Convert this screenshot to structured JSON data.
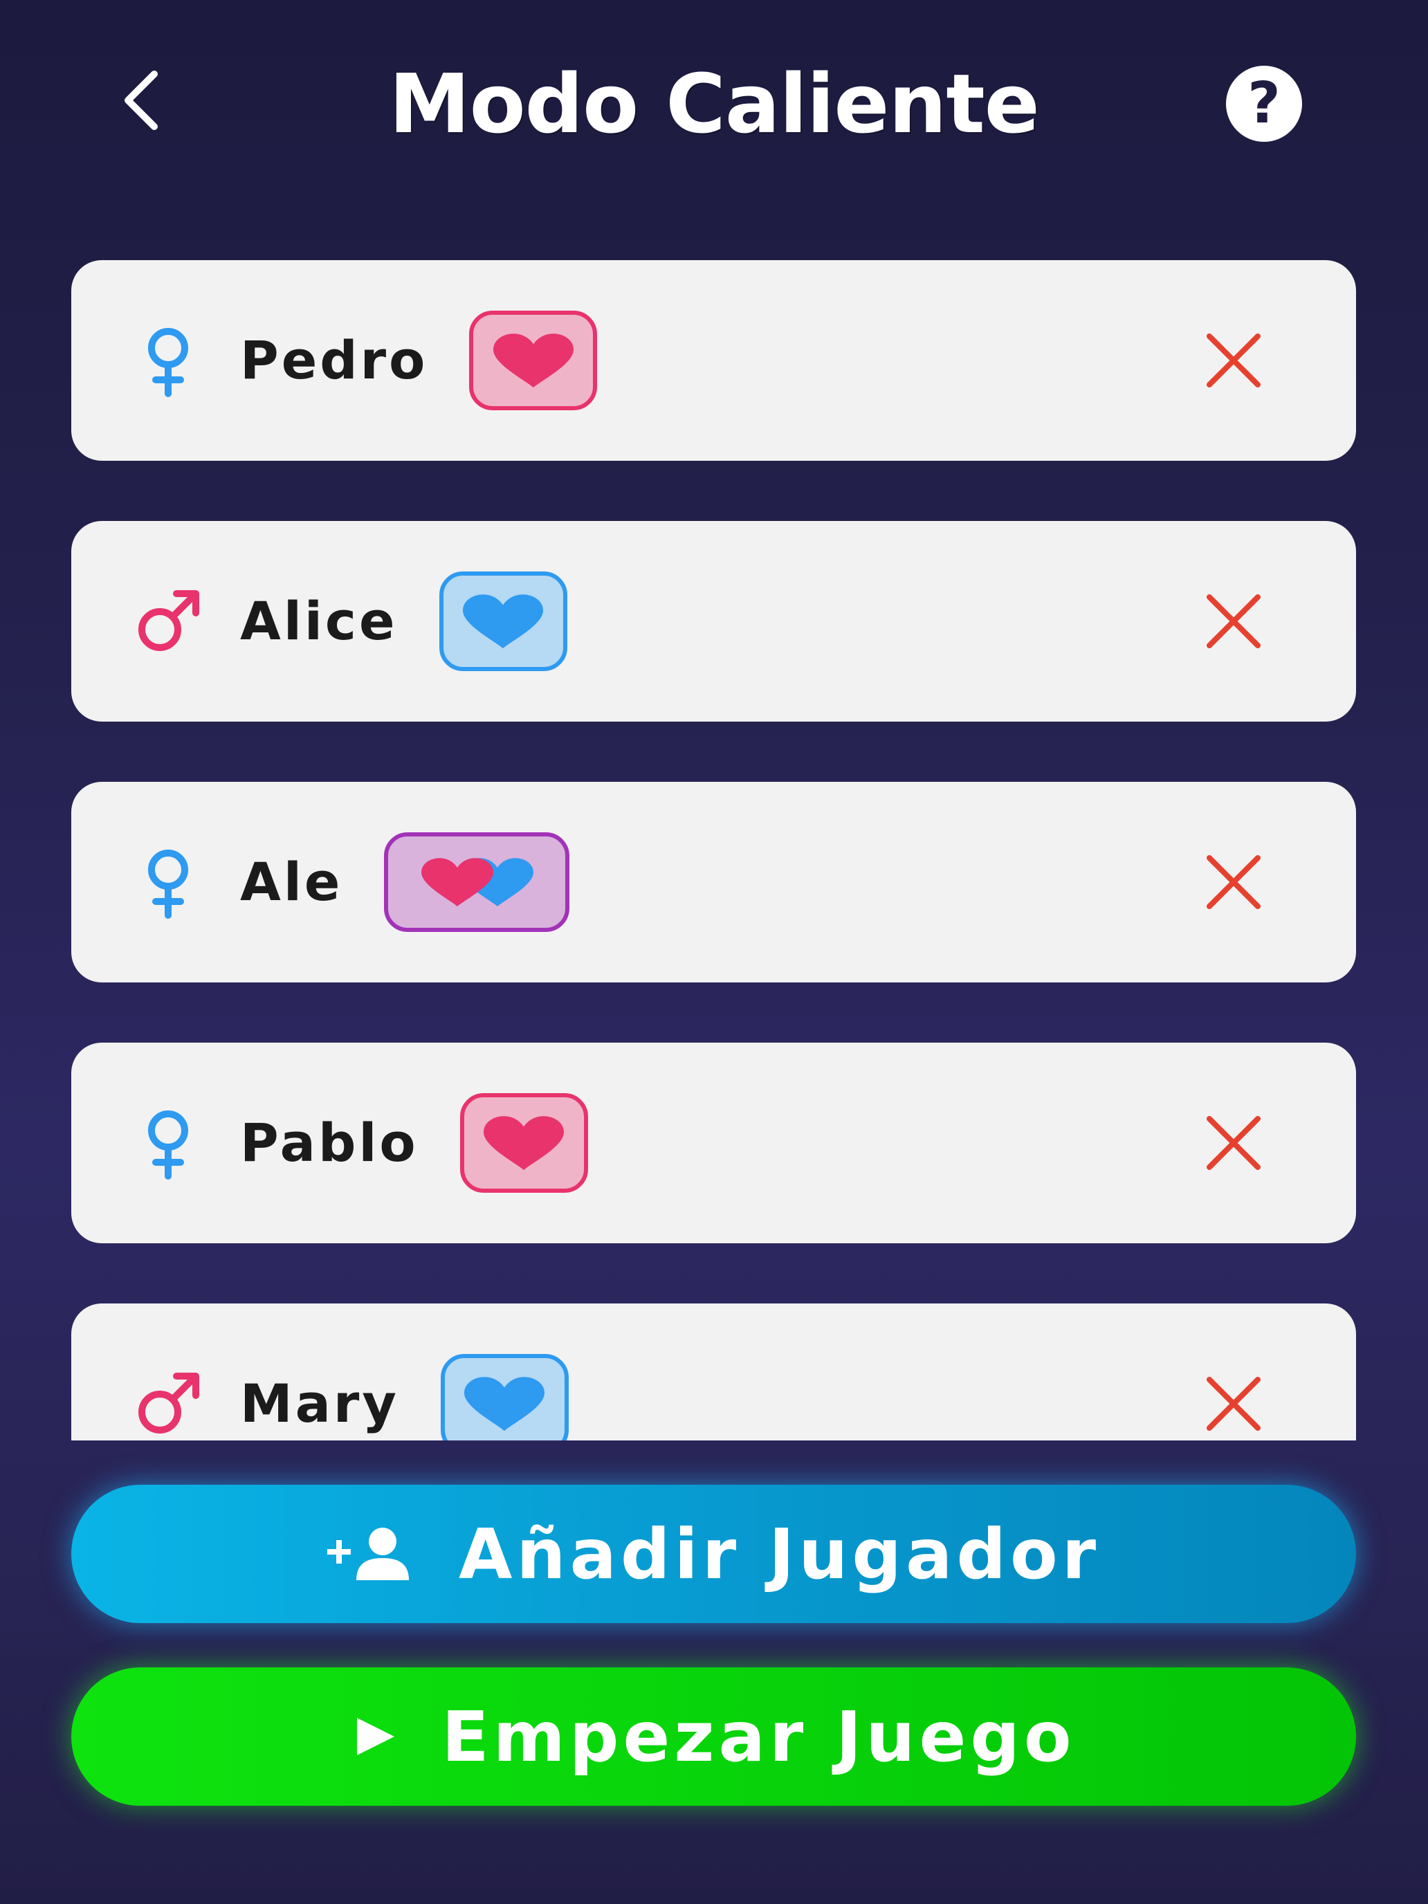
{
  "header": {
    "title": "Modo Caliente",
    "back_icon": "chevron-left-icon",
    "help_icon": "question-circle-icon",
    "help_glyph": "?"
  },
  "players": [
    {
      "name": "Pedro",
      "gender": "female",
      "preference": "women"
    },
    {
      "name": "Alice",
      "gender": "male",
      "preference": "men"
    },
    {
      "name": "Ale",
      "gender": "female",
      "preference": "both"
    },
    {
      "name": "Pablo",
      "gender": "female",
      "preference": "women"
    },
    {
      "name": "Mary",
      "gender": "male",
      "preference": "men"
    }
  ],
  "colors": {
    "female_symbol": "#2e9af0",
    "male_symbol": "#e8336d",
    "remove": "#e6412f",
    "heart_pink": "#e8336d",
    "heart_blue": "#2e9af0"
  },
  "buttons": {
    "add_player": {
      "label": "Añadir Jugador",
      "icon": "add-person-icon"
    },
    "start_game": {
      "label": "Empezar Juego",
      "icon": "play-icon"
    }
  }
}
